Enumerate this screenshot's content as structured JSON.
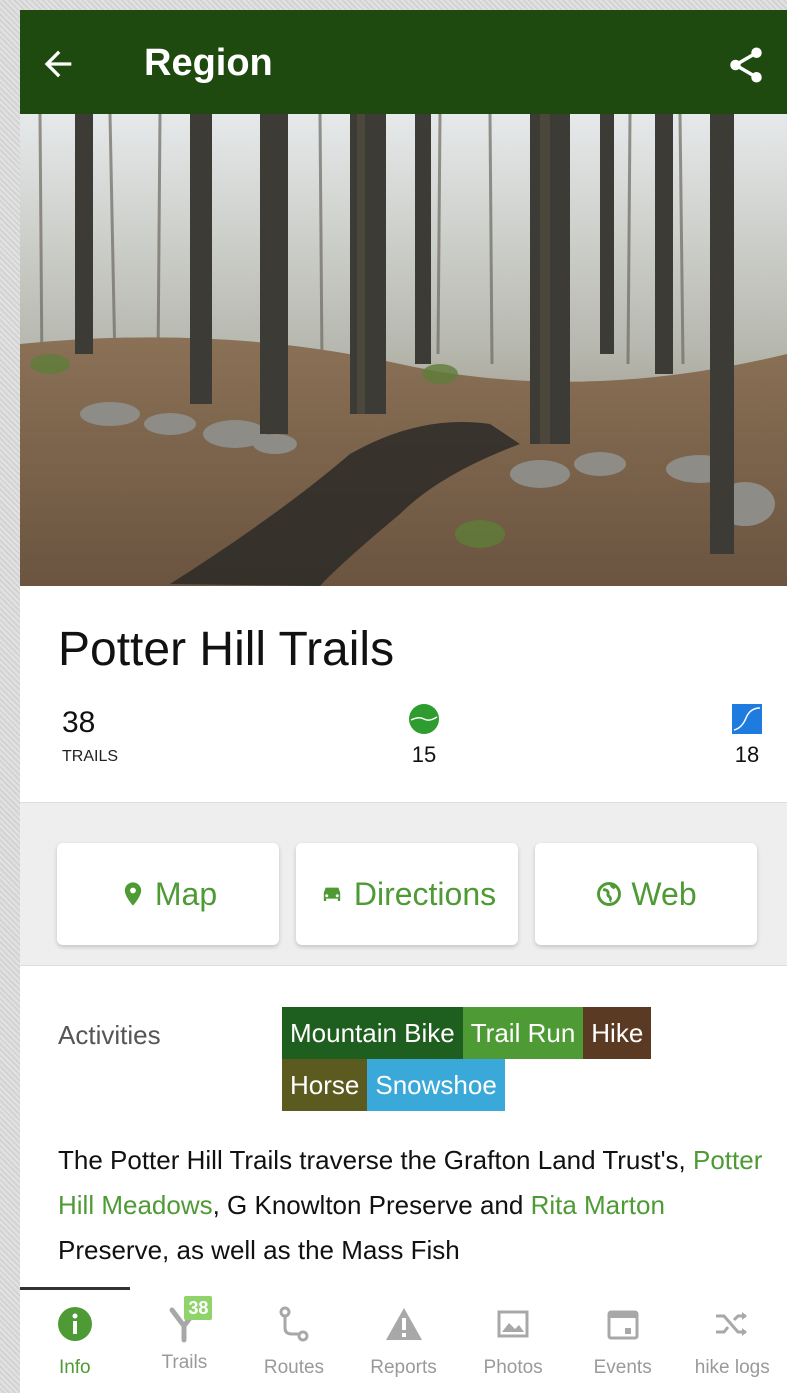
{
  "appbar": {
    "title": "Region",
    "back_icon": "arrow-left-icon",
    "share_icon": "share-icon",
    "color": "#1e4a0f"
  },
  "hero": {
    "description": "forest photo"
  },
  "region": {
    "title": "Potter Hill Trails"
  },
  "stats": {
    "trail_count": "38",
    "trail_count_label": "TRAILS",
    "easy_count": "15",
    "hard_count": "18"
  },
  "actions": {
    "map_label": "Map",
    "directions_label": "Directions",
    "web_label": "Web",
    "accent": "#4e9a35"
  },
  "activities": {
    "label": "Activities",
    "chips": [
      {
        "label": "Mountain Bike",
        "color": "#1e5e1e"
      },
      {
        "label": "Trail Run",
        "color": "#4e9a35"
      },
      {
        "label": "Hike",
        "color": "#5a3a22"
      },
      {
        "label": "Horse",
        "color": "#5b5a1f"
      },
      {
        "label": "Snowshoe",
        "color": "#3aa8d8"
      }
    ]
  },
  "description": {
    "p1": "The Potter Hill Trails traverse the Grafton Land Trust's, ",
    "link1": "Potter Hill Meadows",
    "p2": ", G Knowlton Preserve and ",
    "link2": "Rita Marton",
    "p3": " Preserve, as well as the Mass Fish"
  },
  "bottom_nav": [
    {
      "label": "Info",
      "icon": "info-icon",
      "active": true
    },
    {
      "label": "Trails",
      "icon": "trails-fork-icon",
      "badge": "38"
    },
    {
      "label": "Routes",
      "icon": "routes-icon"
    },
    {
      "label": "Reports",
      "icon": "warning-icon"
    },
    {
      "label": "Photos",
      "icon": "photos-icon"
    },
    {
      "label": "Events",
      "icon": "calendar-icon"
    },
    {
      "label": "hike logs",
      "icon": "shuffle-icon"
    }
  ]
}
